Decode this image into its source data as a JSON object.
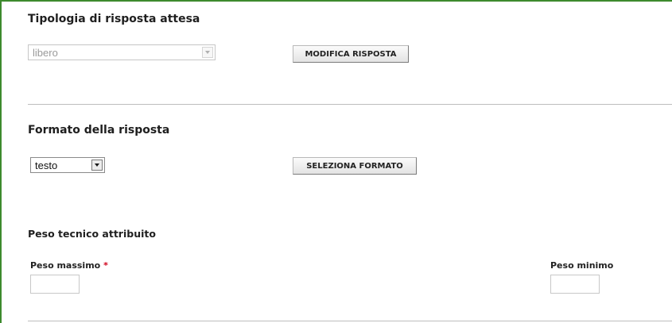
{
  "sections": {
    "tipologia": {
      "heading": "Tipologia di risposta attesa",
      "select_value": "libero",
      "button_label": "MODIFICA RISPOSTA"
    },
    "formato": {
      "heading": "Formato della risposta",
      "select_value": "testo",
      "button_label": "SELEZIONA FORMATO"
    },
    "peso": {
      "heading": "Peso tecnico attribuito",
      "max_label": "Peso massimo",
      "required_marker": "*",
      "min_label": "Peso minimo",
      "max_value": "",
      "min_value": ""
    }
  },
  "colors": {
    "frame_border": "#3d8a2d",
    "required": "#d0021b",
    "divider": "#bdbdbd"
  },
  "icons": [
    "chevron-down-icon"
  ]
}
